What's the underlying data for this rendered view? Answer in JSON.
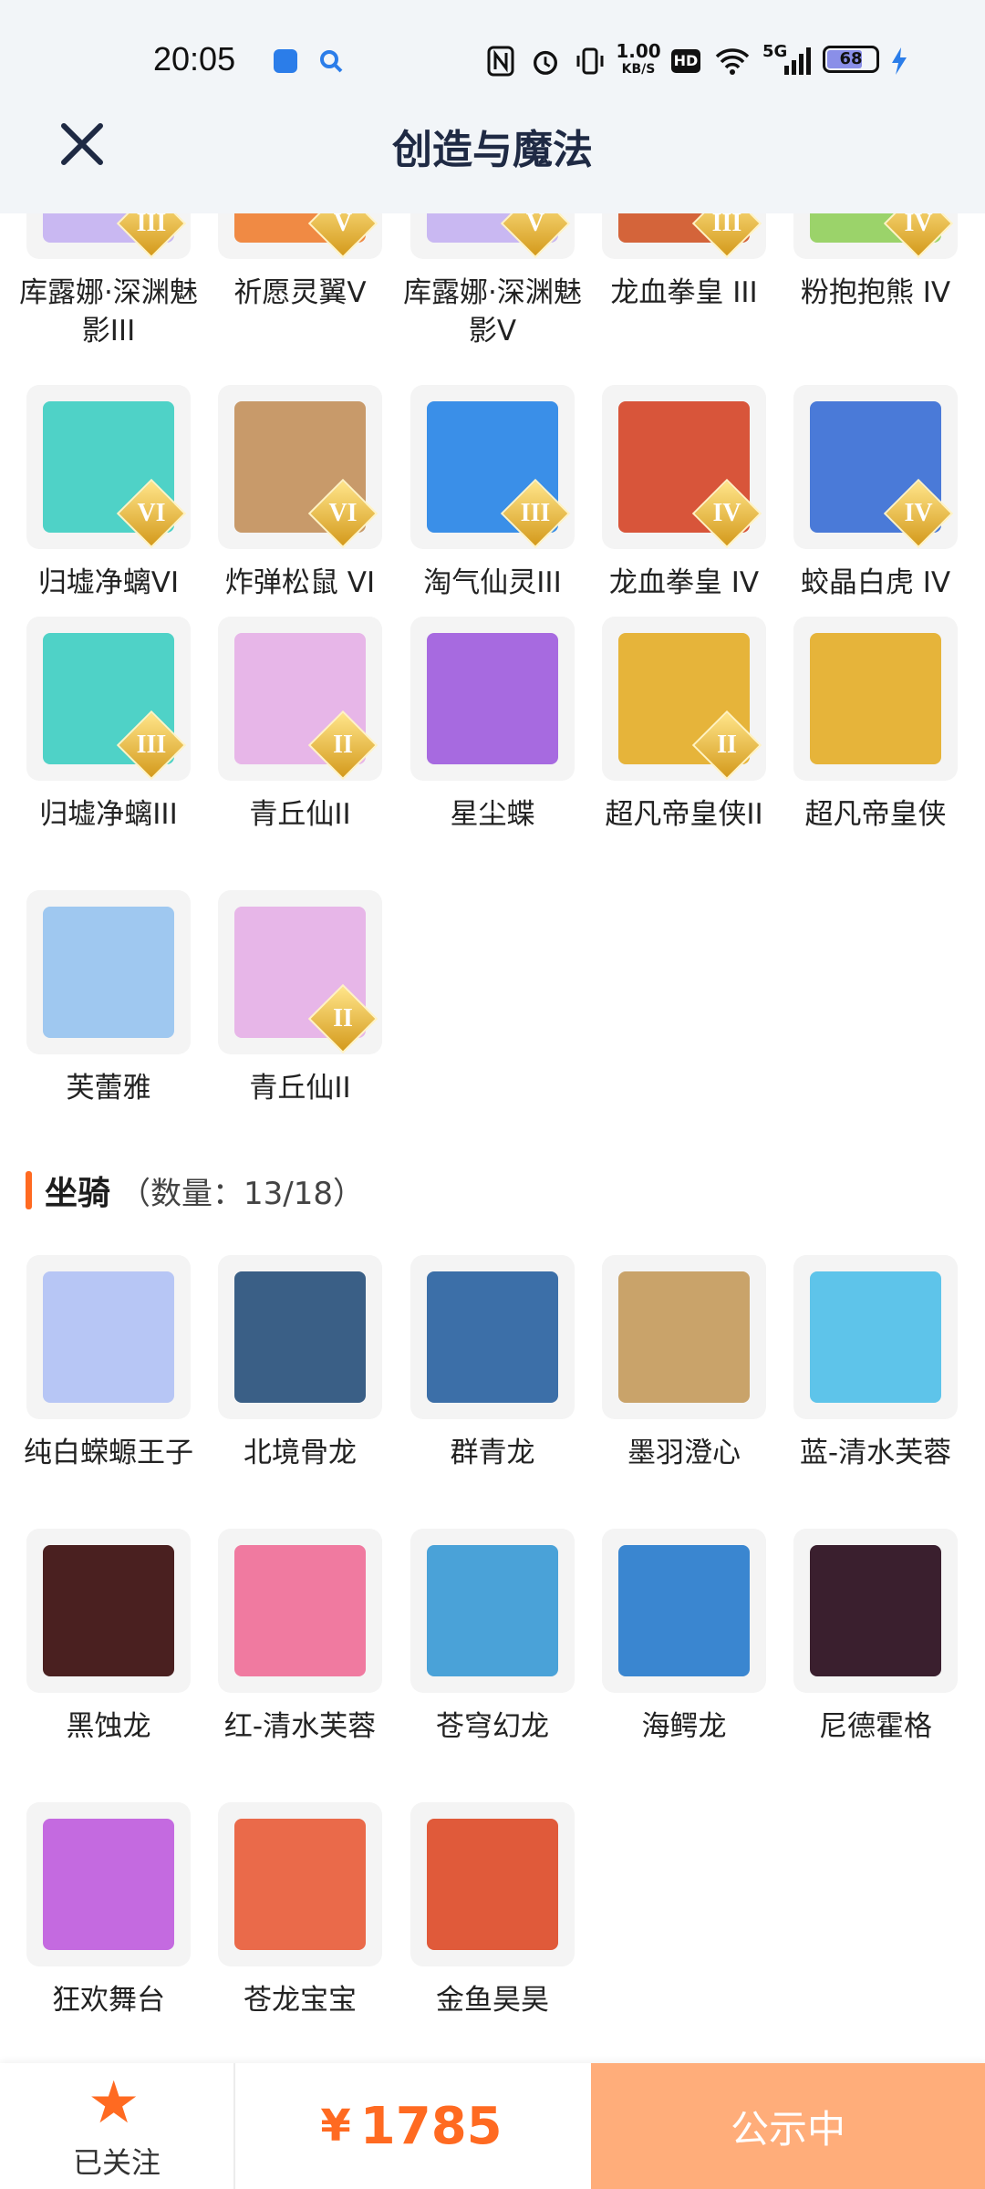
{
  "status_bar": {
    "time": "20:05",
    "net_speed_top": "1.00",
    "net_speed_unit": "KB/S",
    "hd": "HD",
    "signal": "5G",
    "battery": "68"
  },
  "header": {
    "title": "创造与魔法"
  },
  "pets": [
    {
      "name": "库露娜·深渊魅影III",
      "rank": "III",
      "color": "#c9b8f2"
    },
    {
      "name": "祈愿灵翼V",
      "rank": "V",
      "color": "#f08a44"
    },
    {
      "name": "库露娜·深渊魅影V",
      "rank": "V",
      "color": "#c9b8f2"
    },
    {
      "name": "龙血拳皇 III",
      "rank": "III",
      "color": "#d4643a"
    },
    {
      "name": "粉抱抱熊 IV",
      "rank": "IV",
      "color": "#9bd36a"
    },
    {
      "name": "归墟净螭VI",
      "rank": "VI",
      "color": "#4fd2c7"
    },
    {
      "name": "炸弹松鼠 VI",
      "rank": "VI",
      "color": "#c89a6a"
    },
    {
      "name": "淘气仙灵III",
      "rank": "III",
      "color": "#3a8fe8"
    },
    {
      "name": "龙血拳皇 IV",
      "rank": "IV",
      "color": "#d8553a"
    },
    {
      "name": "蛟晶白虎 IV",
      "rank": "IV",
      "color": "#4a7ad8"
    },
    {
      "name": "归墟净螭III",
      "rank": "III",
      "color": "#4fd2c7"
    },
    {
      "name": "青丘仙II",
      "rank": "II",
      "color": "#e7b6e8"
    },
    {
      "name": "星尘蝶",
      "rank": "",
      "color": "#a76ae0"
    },
    {
      "name": "超凡帝皇侠II",
      "rank": "II",
      "color": "#e6b43a"
    },
    {
      "name": "超凡帝皇侠",
      "rank": "",
      "color": "#e6b43a"
    },
    {
      "name": "芙蕾雅",
      "rank": "",
      "color": "#9fc8f0"
    },
    {
      "name": "青丘仙II",
      "rank": "II",
      "color": "#e7b6e8"
    }
  ],
  "mounts_section": {
    "title": "坐骑",
    "count": "（数量：13/18）"
  },
  "mounts": [
    {
      "name": "纯白蝾螈王子",
      "color": "#b7c6f5"
    },
    {
      "name": "北境骨龙",
      "color": "#3a5f86"
    },
    {
      "name": "群青龙",
      "color": "#3c6fa8"
    },
    {
      "name": "墨羽澄心",
      "color": "#c9a36a"
    },
    {
      "name": "蓝-清水芙蓉",
      "color": "#5ec4ea"
    },
    {
      "name": "黑蚀龙",
      "color": "#4a2020"
    },
    {
      "name": "红-清水芙蓉",
      "color": "#f07aa0"
    },
    {
      "name": "苍穹幻龙",
      "color": "#4aa2d8"
    },
    {
      "name": "海鳄龙",
      "color": "#3a86d0"
    },
    {
      "name": "尼德霍格",
      "color": "#3a1f2e"
    },
    {
      "name": "狂欢舞台",
      "color": "#c46ae0"
    },
    {
      "name": "苍龙宝宝",
      "color": "#ea6a4a"
    },
    {
      "name": "金鱼昊昊",
      "color": "#e05a3a"
    }
  ],
  "bottom_bar": {
    "follow_label": "已关注",
    "currency": "¥",
    "price": "1785",
    "action": "公示中"
  }
}
